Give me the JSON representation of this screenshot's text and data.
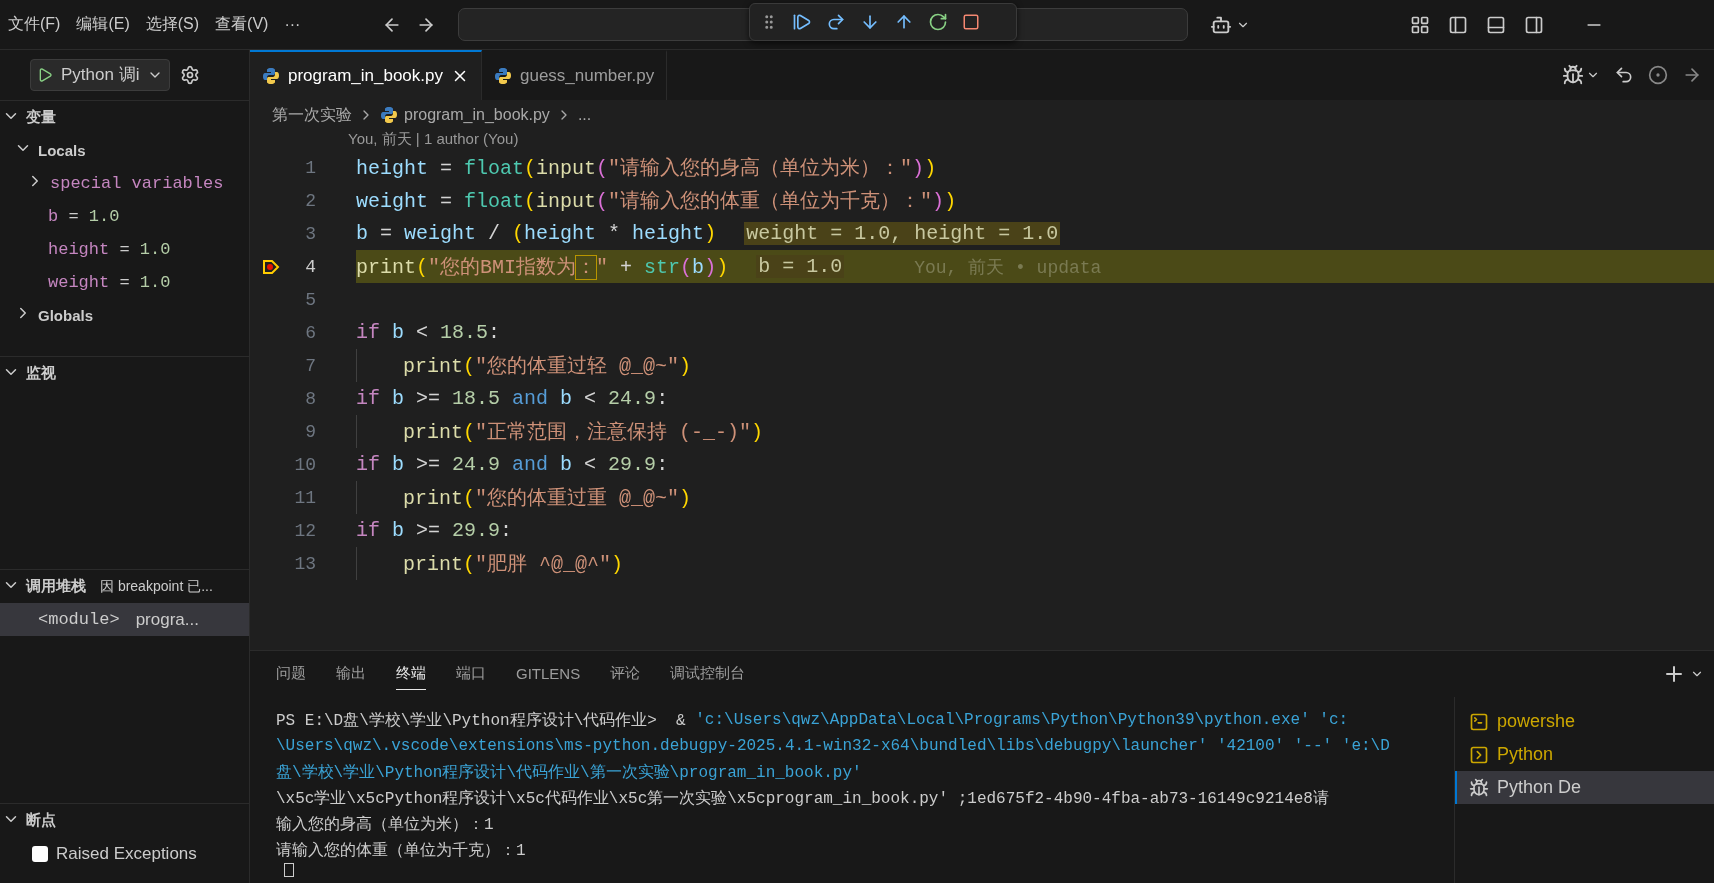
{
  "menu": [
    "文件(F)",
    "编辑(E)",
    "选择(S)",
    "查看(V)",
    "···"
  ],
  "run_config": {
    "label": "Python 调i"
  },
  "editor_tabs": [
    {
      "label": "program_in_book.py",
      "selected": true
    },
    {
      "label": "guess_number.py",
      "selected": false
    }
  ],
  "breadcrumb": [
    "第一次实验",
    "program_in_book.py",
    "..."
  ],
  "codelens": "You, 前天 | 1 author (You)",
  "lines": [
    {
      "number": "1",
      "tokens": [
        {
          "kind": "v",
          "text": "height"
        },
        {
          "kind": "o",
          "text": " = "
        },
        {
          "kind": "t",
          "text": "float"
        },
        {
          "kind": "p1",
          "text": "("
        },
        {
          "kind": "f",
          "text": "input"
        },
        {
          "kind": "p2",
          "text": "("
        },
        {
          "kind": "s",
          "text": "\"请输入您的身高（单位为米）：\""
        },
        {
          "kind": "p2",
          "text": ")"
        },
        {
          "kind": "p1",
          "text": ")"
        }
      ],
      "current": false,
      "breakpoint": false
    },
    {
      "number": "2",
      "tokens": [
        {
          "kind": "v",
          "text": "weight"
        },
        {
          "kind": "o",
          "text": " = "
        },
        {
          "kind": "t",
          "text": "float"
        },
        {
          "kind": "p1",
          "text": "("
        },
        {
          "kind": "f",
          "text": "input"
        },
        {
          "kind": "p2",
          "text": "("
        },
        {
          "kind": "s",
          "text": "\"请输入您的体重（单位为千克）：\""
        },
        {
          "kind": "p2",
          "text": ")"
        },
        {
          "kind": "p1",
          "text": ")"
        }
      ],
      "current": false,
      "breakpoint": false
    },
    {
      "number": "3",
      "tokens": [
        {
          "kind": "v",
          "text": "b"
        },
        {
          "kind": "o",
          "text": " = "
        },
        {
          "kind": "v",
          "text": "weight"
        },
        {
          "kind": "o",
          "text": " / "
        },
        {
          "kind": "p1",
          "text": "("
        },
        {
          "kind": "v",
          "text": "height"
        },
        {
          "kind": "o",
          "text": " * "
        },
        {
          "kind": "v",
          "text": "height"
        },
        {
          "kind": "p1",
          "text": ")"
        }
      ],
      "inline_value": "weight = 1.0, height = 1.0",
      "current": false,
      "breakpoint": false
    },
    {
      "number": "4",
      "tokens": [
        {
          "kind": "f",
          "text": "print"
        },
        {
          "kind": "p1",
          "text": "("
        },
        {
          "kind": "s",
          "text": "\"您的BMI指数为"
        },
        {
          "kind": "sb",
          "text": "："
        },
        {
          "kind": "s",
          "text": "\""
        },
        {
          "kind": "o",
          "text": " + "
        },
        {
          "kind": "t",
          "text": "str"
        },
        {
          "kind": "p2",
          "text": "("
        },
        {
          "kind": "v",
          "text": "b"
        },
        {
          "kind": "p2",
          "text": ")"
        },
        {
          "kind": "p1",
          "text": ")"
        }
      ],
      "inline_value": "b = 1.0",
      "blame": "You, 前天 • updata",
      "current": true,
      "breakpoint": true
    },
    {
      "number": "5",
      "current": false,
      "breakpoint": false
    },
    {
      "number": "6",
      "tokens": [
        {
          "kind": "k",
          "text": "if "
        },
        {
          "kind": "v",
          "text": "b"
        },
        {
          "kind": "o",
          "text": " < "
        },
        {
          "kind": "n",
          "text": "18.5"
        },
        {
          "kind": "o",
          "text": ":"
        }
      ],
      "current": false,
      "breakpoint": false
    },
    {
      "number": "7",
      "indented": true,
      "tokens": [
        {
          "kind": "f",
          "text": "print"
        },
        {
          "kind": "p1",
          "text": "("
        },
        {
          "kind": "s",
          "text": "\"您的体重过轻 @_@~\""
        },
        {
          "kind": "p1",
          "text": ")"
        }
      ],
      "current": false,
      "breakpoint": false
    },
    {
      "number": "8",
      "tokens": [
        {
          "kind": "k",
          "text": "if "
        },
        {
          "kind": "v",
          "text": "b"
        },
        {
          "kind": "o",
          "text": " >= "
        },
        {
          "kind": "n",
          "text": "18.5"
        },
        {
          "kind": "a",
          "text": " and "
        },
        {
          "kind": "v",
          "text": "b"
        },
        {
          "kind": "o",
          "text": " < "
        },
        {
          "kind": "n",
          "text": "24.9"
        },
        {
          "kind": "o",
          "text": ":"
        }
      ],
      "current": false,
      "breakpoint": false
    },
    {
      "number": "9",
      "indented": true,
      "tokens": [
        {
          "kind": "f",
          "text": "print"
        },
        {
          "kind": "p1",
          "text": "("
        },
        {
          "kind": "s",
          "text": "\"正常范围，注意保持 (-_-)\""
        },
        {
          "kind": "p1",
          "text": ")"
        }
      ],
      "current": false,
      "breakpoint": false
    },
    {
      "number": "10",
      "tokens": [
        {
          "kind": "k",
          "text": "if "
        },
        {
          "kind": "v",
          "text": "b"
        },
        {
          "kind": "o",
          "text": " >= "
        },
        {
          "kind": "n",
          "text": "24.9"
        },
        {
          "kind": "a",
          "text": " and "
        },
        {
          "kind": "v",
          "text": "b"
        },
        {
          "kind": "o",
          "text": " < "
        },
        {
          "kind": "n",
          "text": "29.9"
        },
        {
          "kind": "o",
          "text": ":"
        }
      ],
      "current": false,
      "breakpoint": false
    },
    {
      "number": "11",
      "indented": true,
      "tokens": [
        {
          "kind": "f",
          "text": "print"
        },
        {
          "kind": "p1",
          "text": "("
        },
        {
          "kind": "s",
          "text": "\"您的体重过重 @_@~\""
        },
        {
          "kind": "p1",
          "text": ")"
        }
      ],
      "current": false,
      "breakpoint": false
    },
    {
      "number": "12",
      "tokens": [
        {
          "kind": "k",
          "text": "if "
        },
        {
          "kind": "v",
          "text": "b"
        },
        {
          "kind": "o",
          "text": " >= "
        },
        {
          "kind": "n",
          "text": "29.9"
        },
        {
          "kind": "o",
          "text": ":"
        }
      ],
      "current": false,
      "breakpoint": false
    },
    {
      "number": "13",
      "indented": true,
      "tokens": [
        {
          "kind": "f",
          "text": "print"
        },
        {
          "kind": "p1",
          "text": "("
        },
        {
          "kind": "s",
          "text": "\"肥胖 ^@_@^\""
        },
        {
          "kind": "p1",
          "text": ")"
        }
      ],
      "current": false,
      "breakpoint": false
    }
  ],
  "variables": {
    "title": "变量",
    "expanded": true,
    "scopes": [
      {
        "label": "Locals",
        "expanded": true,
        "children": [
          {
            "label": "special variables",
            "expanded": false,
            "kind": "group"
          },
          {
            "name": "b",
            "op": "=",
            "value": "1.0",
            "kind": "var"
          },
          {
            "name": "height",
            "op": "=",
            "value": "1.0",
            "kind": "var"
          },
          {
            "name": "weight",
            "op": "=",
            "value": "1.0",
            "kind": "var"
          }
        ]
      },
      {
        "label": "Globals",
        "expanded": false
      }
    ]
  },
  "watch": {
    "title": "监视",
    "expanded": true
  },
  "call_stack": {
    "title": "调用堆栈",
    "expanded": true,
    "status": "因 breakpoint 已...",
    "frames": [
      {
        "name": "<module>",
        "file": "progra...",
        "selected": true
      }
    ]
  },
  "breakpoints": {
    "title": "断点",
    "expanded": true,
    "items": [
      {
        "label": "Raised Exceptions",
        "checked": false
      }
    ]
  },
  "panel_tabs": [
    {
      "label": "问题",
      "selected": false
    },
    {
      "label": "输出",
      "selected": false
    },
    {
      "label": "终端",
      "selected": true
    },
    {
      "label": "端口",
      "selected": false
    },
    {
      "label": "GITLENS",
      "selected": false
    },
    {
      "label": "评论",
      "selected": false
    },
    {
      "label": "调试控制台",
      "selected": false
    }
  ],
  "terminal_lines": [
    [
      {
        "kind": "plain",
        "text": "PS E:\\D盘\\学校\\学业\\Python程序设计\\代码作业>  & "
      },
      {
        "kind": "path",
        "text": "'c:\\Users\\qwz\\AppData\\Local\\Programs\\Python\\Python39\\python.exe' 'c:"
      }
    ],
    [
      {
        "kind": "path",
        "text": "\\Users\\qwz\\.vscode\\extensions\\ms-python.debugpy-2025.4.1-win32-x64\\bundled\\libs\\debugpy\\launcher' '42100' '--' 'e:\\D"
      }
    ],
    [
      {
        "kind": "path",
        "text": "盘\\学校\\学业\\Python程序设计\\代码作业\\第一次实验\\program_in_book.py'"
      }
    ],
    [
      {
        "kind": "plain",
        "text": "\\x5c学业\\x5cPython程序设计\\x5c代码作业\\x5c第一次实验\\x5cprogram_in_book.py' ;1ed675f2-4b90-4fba-ab73-16149c9214e8请"
      }
    ],
    [
      {
        "kind": "plain",
        "text": "输入您的身高（单位为米）：1"
      }
    ],
    [
      {
        "kind": "plain",
        "text": "请输入您的体重（单位为千克）：1"
      }
    ]
  ],
  "terminals": [
    {
      "label": "powershe",
      "kind": "shell",
      "selected": false
    },
    {
      "label": "Python",
      "kind": "task",
      "selected": false
    },
    {
      "label": "Python De",
      "kind": "debug",
      "selected": true
    }
  ]
}
